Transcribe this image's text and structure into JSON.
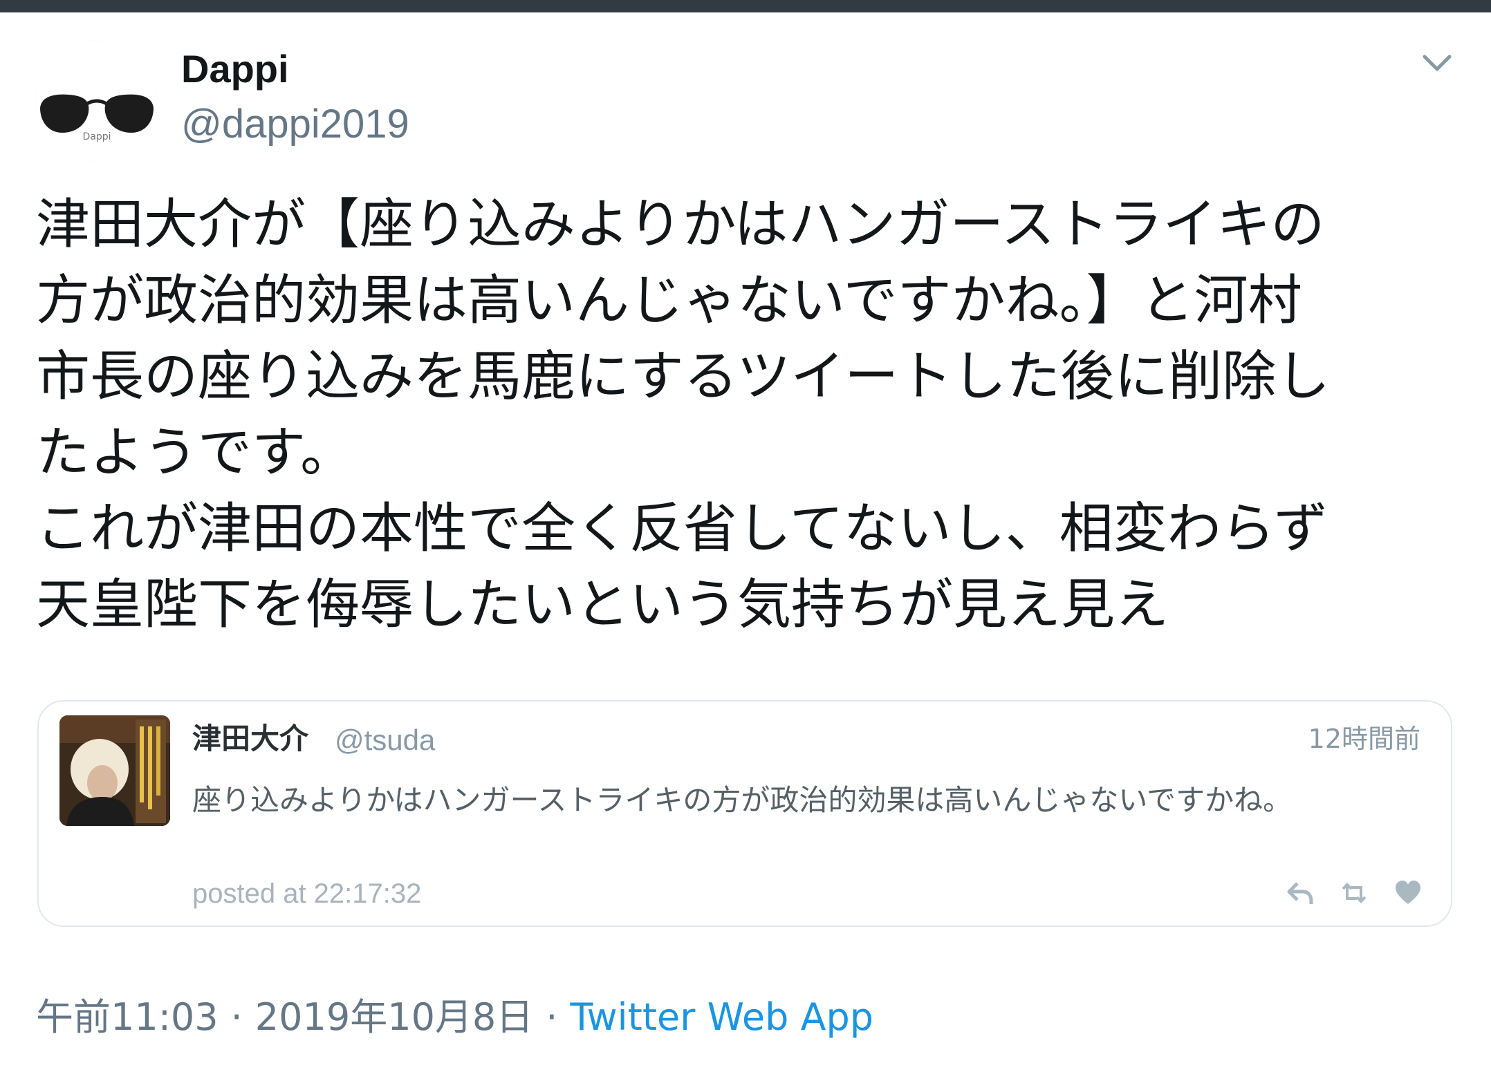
{
  "tweet": {
    "author": {
      "display_name": "Dappi",
      "handle": "@dappi2019",
      "avatar_icon": "sunglasses-icon",
      "avatar_caption": "Dappi"
    },
    "text_lines": [
      "津田大介が【座り込みよりかはハンガーストライキの",
      "方が政治的効果は高いんじゃないですかね。】と河村",
      "市長の座り込みを馬鹿にするツイートした後に削除し",
      "たようです。",
      "これが津田の本性で全く反省してないし、相変わらず",
      "天皇陛下を侮辱したいという気持ちが見え見え"
    ],
    "quoted": {
      "name": "津田大介",
      "handle": "@tsuda",
      "time": "12時間前",
      "text": "座り込みよりかはハンガーストライキの方が政治的効果は高いんじゃないですかね。",
      "posted": "posted at 22:17:32",
      "actions": [
        "reply-icon",
        "retweet-icon",
        "like-icon"
      ]
    },
    "footer": {
      "time": "午前11:03",
      "separator": "·",
      "date": "2019年10月8日",
      "app": "Twitter Web App"
    }
  },
  "colors": {
    "link": "#1b95e0",
    "secondary_text": "#657786",
    "top_strip": "#323a42"
  }
}
